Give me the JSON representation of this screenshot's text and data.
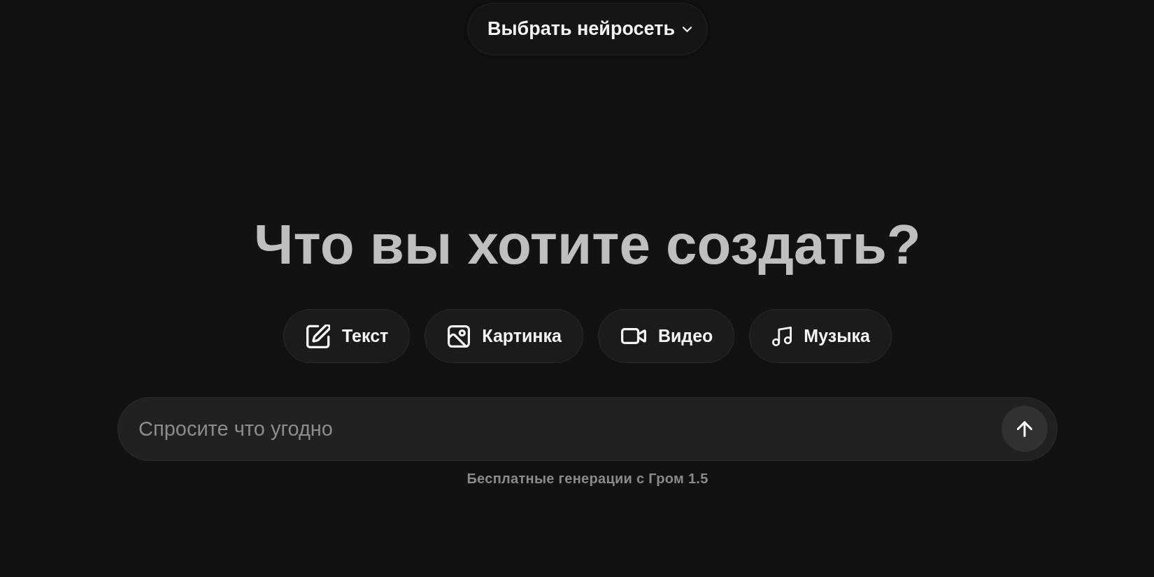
{
  "model_selector": {
    "label": "Выбрать нейросеть"
  },
  "heading": "Что вы хотите создать?",
  "modes": [
    {
      "kind": "text",
      "label": "Текст"
    },
    {
      "kind": "image",
      "label": "Картинка"
    },
    {
      "kind": "video",
      "label": "Видео"
    },
    {
      "kind": "music",
      "label": "Музыка"
    }
  ],
  "prompt": {
    "placeholder": "Спросите что угодно"
  },
  "footer": "Бесплатные генерации с Гром 1.5"
}
